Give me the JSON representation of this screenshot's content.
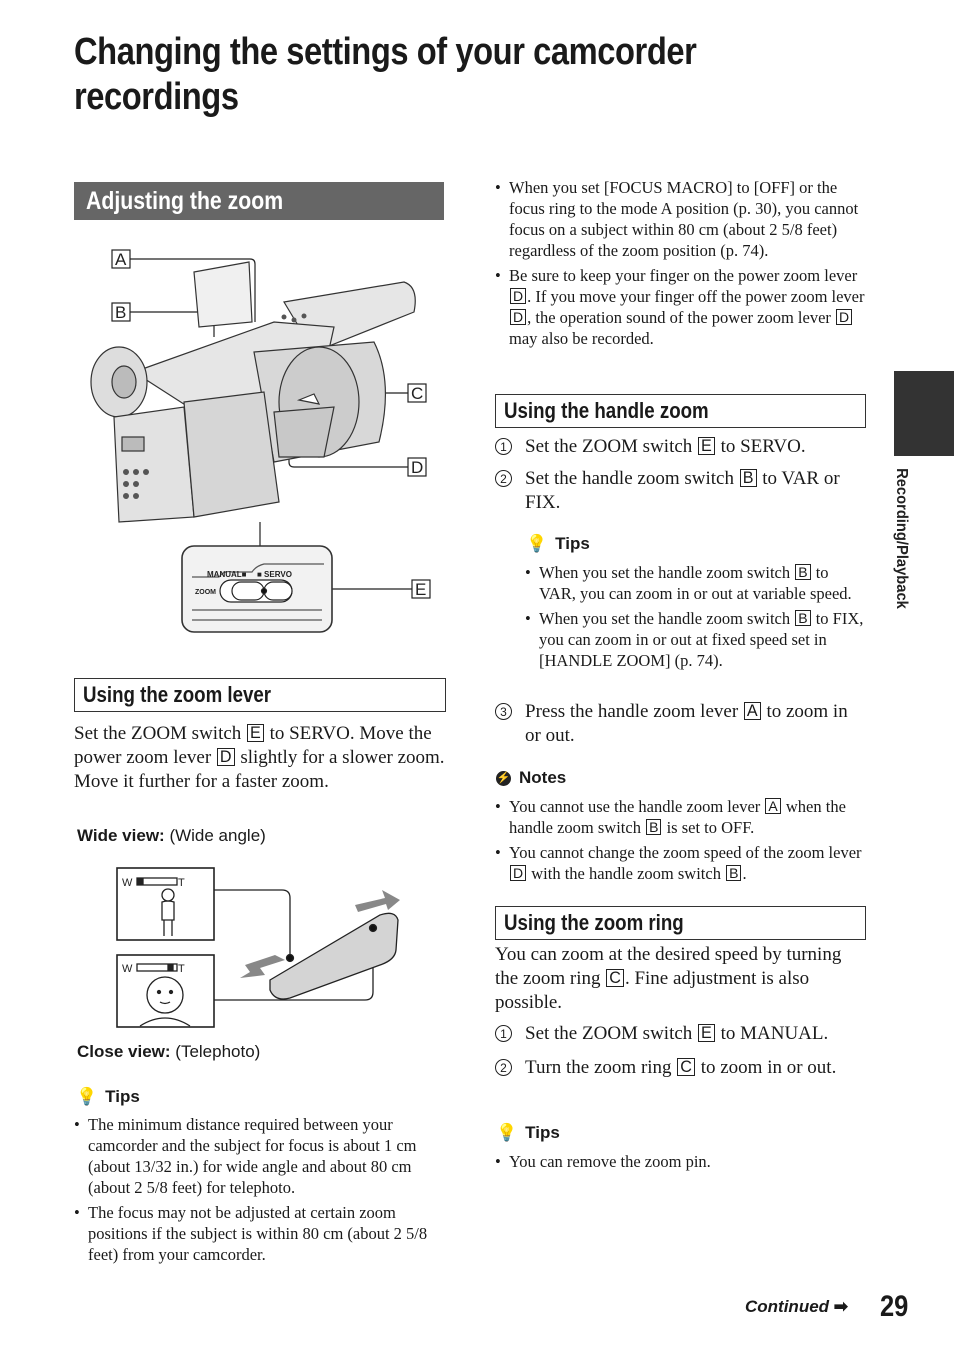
{
  "page": {
    "title": "Changing the settings of your camcorder recordings",
    "side_tab_label": "Recording/Playback",
    "footer_continued": "Continued",
    "page_number": "29",
    "accent_dark": "#333333",
    "banner_gray": "#666666"
  },
  "left": {
    "section_banner": "Adjusting the zoom",
    "figure_camcorder": {
      "callouts": [
        "A",
        "B",
        "C",
        "D",
        "E"
      ],
      "switch_labels": {
        "manual": "MANUAL",
        "servo": "SERVO",
        "zoom": "ZOOM"
      }
    },
    "zoom_lever": {
      "heading": "Using the zoom lever",
      "body_1": "Set the ZOOM switch",
      "body_key_e": "E",
      "body_2": "to SERVO. Move the power zoom lever",
      "body_key_d": "D",
      "body_3": "slightly for a slower zoom. Move it further for a faster zoom.",
      "wide_label": "Wide view:",
      "wide_desc": "(Wide angle)",
      "close_label": "Close view:",
      "close_desc": "(Telephoto)",
      "figure": {
        "w": "W",
        "t": "T"
      }
    },
    "tips": {
      "heading": "Tips",
      "items": [
        "The minimum distance required between your camcorder and the subject for focus is about 1 cm (about 13/32 in.) for wide angle and about 80 cm (about 2 5/8 feet) for telephoto.",
        "The focus may not be adjusted at certain zoom positions if the subject is within 80 cm (about 2 5/8 feet) from your camcorder."
      ]
    }
  },
  "right": {
    "top_bullets": {
      "b1": "When you set [FOCUS MACRO] to [OFF] or the focus ring to the mode A position (p. 30), you cannot focus on a subject within 80 cm (about 2 5/8 feet) regardless of the zoom position (p. 74).",
      "b2_a": "Be sure to keep your finger on the power zoom lever",
      "b2_b": ". If you move your finger off the power zoom lever",
      "b2_c": ", the operation sound of the power zoom lever",
      "b2_d": "may also be recorded.",
      "key_d": "D"
    },
    "handle_zoom": {
      "heading": "Using the handle zoom",
      "step1_num": "1",
      "step1_a": "Set the ZOOM switch",
      "step1_key": "E",
      "step1_b": "to SERVO.",
      "step2_num": "2",
      "step2_a": "Set the handle zoom switch",
      "step2_key": "B",
      "step2_b": "to VAR or FIX.",
      "tips_heading": "Tips",
      "tip1_a": "When you set the handle zoom switch",
      "tip1_key": "B",
      "tip1_b": "to VAR, you can zoom in or out at variable speed.",
      "tip2_a": "When you set the handle zoom switch",
      "tip2_key": "B",
      "tip2_b": "to FIX, you can zoom in or out at fixed speed set in [HANDLE ZOOM] (p. 74).",
      "step3_num": "3",
      "step3_a": "Press the handle zoom lever",
      "step3_key": "A",
      "step3_b": "to zoom in or out.",
      "notes_heading": "Notes",
      "note1_a": "You cannot use the handle zoom lever",
      "note1_key1": "A",
      "note1_b": "when the handle zoom switch",
      "note1_key2": "B",
      "note1_c": "is set to OFF.",
      "note2_a": "You cannot change the zoom speed of the zoom lever",
      "note2_key1": "D",
      "note2_b": "with the handle zoom switch",
      "note2_key2": "B",
      "note2_c": "."
    },
    "zoom_ring": {
      "heading": "Using the zoom ring",
      "body_a": "You can zoom at the desired speed by turning the zoom ring",
      "body_key": "C",
      "body_b": ". Fine adjustment is also possible.",
      "step1_num": "1",
      "step1_a": "Set the ZOOM switch",
      "step1_key": "E",
      "step1_b": "to MANUAL.",
      "step2_num": "2",
      "step2_a": "Turn the zoom ring",
      "step2_key": "C",
      "step2_b": "to zoom in or out.",
      "tips_heading": "Tips",
      "tip1": "You can remove the zoom pin."
    }
  }
}
